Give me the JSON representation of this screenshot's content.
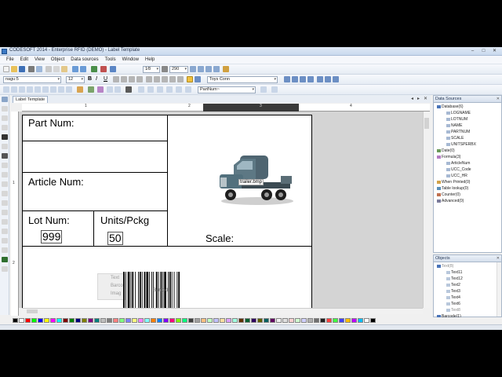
{
  "window": {
    "title": "CODESOFT 2014 - Enterprise RFID (DEMO) - Label Template",
    "minimize": "–",
    "maximize": "□",
    "close": "✕"
  },
  "menu": [
    "File",
    "Edit",
    "View",
    "Object",
    "Data sources",
    "Tools",
    "Window",
    "Help"
  ],
  "toolbar": {
    "zoom_value": "290",
    "printer_icon_label": "1⁄8",
    "font_name": "nagu:5",
    "font_size": "12",
    "font_style_buttons": [
      "B",
      "I",
      "U"
    ],
    "printer_value": "Toys Conn",
    "field_value": "PartNum~"
  },
  "document": {
    "tab_label": "Label Template",
    "ruler_h": [
      "1",
      "2",
      "3",
      "4"
    ],
    "ruler_v": [
      "1",
      "2"
    ]
  },
  "label": {
    "part_num": "Part Num:",
    "article_num": "Article Num:",
    "lot_num": "Lot Num:",
    "lot_value": "999",
    "units": "Units/Pckg",
    "units_value": "50",
    "scale": "Scale:",
    "image_tag": "trailer.bmp",
    "barcode_tag": "Barcod",
    "ghost_text": "Text",
    "ghost_barcode": "Barco",
    "ghost_image": "Imag"
  },
  "data_sources": {
    "title": "Data Sources",
    "items": [
      {
        "label": "Database(6)",
        "indent": 0,
        "kind": "db"
      },
      {
        "label": "LOGNAME",
        "indent": 2,
        "kind": "field"
      },
      {
        "label": "LOTNUM",
        "indent": 2,
        "kind": "field"
      },
      {
        "label": "NAME",
        "indent": 2,
        "kind": "field"
      },
      {
        "label": "PARTNUM",
        "indent": 2,
        "kind": "field"
      },
      {
        "label": "SCALE",
        "indent": 2,
        "kind": "field"
      },
      {
        "label": "UNITSPERBX",
        "indent": 2,
        "kind": "field"
      },
      {
        "label": "Date(0)",
        "indent": 0,
        "kind": "date"
      },
      {
        "label": "Formula(3)",
        "indent": 0,
        "kind": "formula"
      },
      {
        "label": "ArticleNum",
        "indent": 2,
        "kind": "field"
      },
      {
        "label": "UCC_Code",
        "indent": 2,
        "kind": "field"
      },
      {
        "label": "UCC_HR",
        "indent": 2,
        "kind": "field"
      },
      {
        "label": "When Printed(0)",
        "indent": 0,
        "kind": "print"
      },
      {
        "label": "Table lookup(0)",
        "indent": 0,
        "kind": "table"
      },
      {
        "label": "Counter(0)",
        "indent": 0,
        "kind": "counter"
      },
      {
        "label": "Advanced(0)",
        "indent": 0,
        "kind": "advanced"
      }
    ]
  },
  "objects": {
    "title": "Objects",
    "items": [
      {
        "label": "Text(8)",
        "indent": 0,
        "state": "dim"
      },
      {
        "label": "Text11",
        "indent": 2,
        "state": "normal"
      },
      {
        "label": "Text12",
        "indent": 2,
        "state": "normal"
      },
      {
        "label": "Text2",
        "indent": 2,
        "state": "normal"
      },
      {
        "label": "Text3",
        "indent": 2,
        "state": "normal"
      },
      {
        "label": "Text4",
        "indent": 2,
        "state": "normal"
      },
      {
        "label": "Text6",
        "indent": 2,
        "state": "normal"
      },
      {
        "label": "Text8",
        "indent": 2,
        "state": "dim"
      },
      {
        "label": "Barcode(1)",
        "indent": 0,
        "state": "normal"
      },
      {
        "label": "Barcode1",
        "indent": 2,
        "state": "normal"
      },
      {
        "label": "Image(1)",
        "indent": 0,
        "state": "normal"
      },
      {
        "label": "Image1",
        "indent": 2,
        "state": "dim"
      },
      {
        "label": "OLE(0)",
        "indent": 0,
        "state": "dim"
      },
      {
        "label": "Line(3)",
        "indent": 0,
        "state": "dim"
      },
      {
        "label": "Line1",
        "indent": 2,
        "state": "normal"
      },
      {
        "label": "Line3",
        "indent": 2,
        "state": "red"
      }
    ]
  },
  "palette_colors": [
    "#000000",
    "#ffffff",
    "#ff0000",
    "#00ff00",
    "#0000ff",
    "#ffff00",
    "#ff00ff",
    "#00ffff",
    "#800000",
    "#008000",
    "#000080",
    "#808000",
    "#800080",
    "#008080",
    "#c0c0c0",
    "#808080",
    "#ff8080",
    "#80ff80",
    "#8080ff",
    "#ffff80",
    "#ff80ff",
    "#80ffff",
    "#ff8000",
    "#0080ff",
    "#8000ff",
    "#ff0080",
    "#80ff00",
    "#00ff80",
    "#404040",
    "#a0a0a0",
    "#ffc080",
    "#c0ffc0",
    "#c0c0ff",
    "#ffe0a0",
    "#e0a0ff",
    "#a0ffe0",
    "#603000",
    "#006030",
    "#300060",
    "#606000",
    "#006060",
    "#600060",
    "#f0f0f0",
    "#e0e0e0",
    "#ffd0d0",
    "#d0ffd0",
    "#d0d0ff",
    "#b0b0b0",
    "#707070",
    "#202020",
    "#ff4040",
    "#40ff40",
    "#4040ff",
    "#ffc000",
    "#c000ff",
    "#00c0ff",
    "#ffffff",
    "#000000"
  ],
  "colors": {
    "accent": "#3a78c4",
    "ruler_dark": "#3a3a3a",
    "selection_red": "#c00000"
  }
}
